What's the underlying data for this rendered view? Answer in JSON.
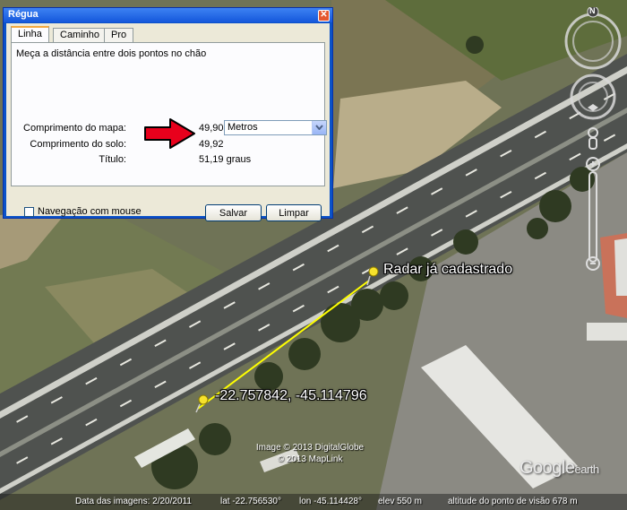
{
  "dialog": {
    "title": "Régua",
    "close_glyph": "✕",
    "tabs": [
      {
        "label": "Linha",
        "active": true
      },
      {
        "label": "Caminho",
        "active": false
      },
      {
        "label": "Pro",
        "active": false
      }
    ],
    "description": "Meça a distância entre dois pontos no chão",
    "map_length_label": "Comprimento do mapa:",
    "map_length_value": "49,90",
    "unit_selected": "Metros",
    "ground_length_label": "Comprimento do solo:",
    "ground_length_value": "49,92",
    "heading_label": "Título:",
    "heading_value": "51,19 graus",
    "mouse_navigation_label": "Navegação com mouse",
    "mouse_navigation_checked": false,
    "save_label": "Salvar",
    "clear_label": "Limpar"
  },
  "map": {
    "placemark_1_label": "Radar já cadastrado",
    "placemark_2_label": "-22.757842, -45.114796",
    "copyright_1": "Image © 2013 DigitalGlobe",
    "copyright_2": "© 2013 MapLink",
    "logo_text_1": "Google",
    "logo_text_2": "earth",
    "compass_letter": "N",
    "colors": {
      "ruler_line": "#ffff00",
      "arrow": "#e8001c"
    }
  },
  "statusbar": {
    "imagery_date": "Data das imagens: 2/20/2011",
    "lat": "lat  -22.756530°",
    "lon": "lon  -45.114428°",
    "elev": "elev   550 m",
    "eye_alt": "altitude do ponto de visão   678 m"
  }
}
